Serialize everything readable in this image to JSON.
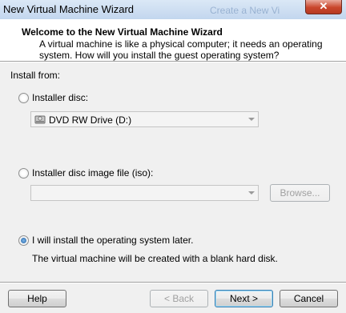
{
  "window": {
    "title": "New Virtual Machine Wizard",
    "background_title": "Create a New Vi",
    "close_symbol": "✕"
  },
  "header": {
    "title": "Welcome to the New Virtual Machine Wizard",
    "description": "A virtual machine is like a physical computer; it needs an operating system. How will you install the guest operating system?"
  },
  "install": {
    "section_label": "Install from:",
    "options": [
      {
        "label": "Installer disc:",
        "selected": false
      },
      {
        "label": "Installer disc image file (iso):",
        "selected": false
      },
      {
        "label": "I will install the operating system later.",
        "selected": true
      }
    ],
    "disc_drive_value": "DVD RW Drive (D:)",
    "iso_path_value": "",
    "browse_label": "Browse...",
    "later_note": "The virtual machine will be created with a blank hard disk."
  },
  "footer": {
    "help_label": "Help",
    "back_label": "< Back",
    "next_label": "Next >",
    "cancel_label": "Cancel"
  },
  "icons": {
    "close": "close-icon",
    "drive": "dvd-drive-icon",
    "dropdown": "chevron-down-icon"
  }
}
